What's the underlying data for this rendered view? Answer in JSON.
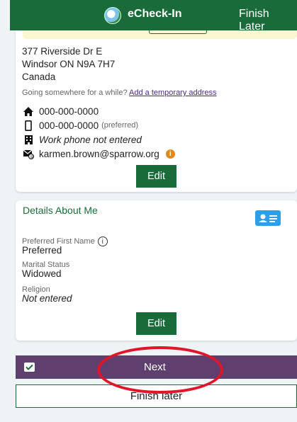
{
  "header": {
    "title": "eCheck-In",
    "finish_label": "Finish Later"
  },
  "address": {
    "line1": "377 Riverside Dr E",
    "line2": "Windsor ON N9A 7H7",
    "line3": "Canada",
    "temp_prompt": "Going somewhere for a while?",
    "temp_link": "Add a temporary address"
  },
  "contact": {
    "home_phone": "000-000-0000",
    "mobile_phone": "000-000-0000",
    "mobile_pref": "(preferred)",
    "work_phone": "Work phone not entered",
    "email": "karmen.brown@sparrow.org"
  },
  "contact_edit_label": "Edit",
  "details": {
    "heading": "Details About Me",
    "preferred_first_name_label": "Preferred First Name",
    "preferred_first_name_value": "Preferred",
    "marital_status_label": "Marital Status",
    "marital_status_value": "Widowed",
    "religion_label": "Religion",
    "religion_value": "Not entered",
    "edit_label": "Edit"
  },
  "footer": {
    "next_label": "Next",
    "finish_later_label": "Finish later"
  },
  "colors": {
    "brand_green": "#1a6b3a",
    "next_purple": "#5e3f6e",
    "annotation_red": "#e2142a",
    "info_orange": "#e08a1a"
  }
}
